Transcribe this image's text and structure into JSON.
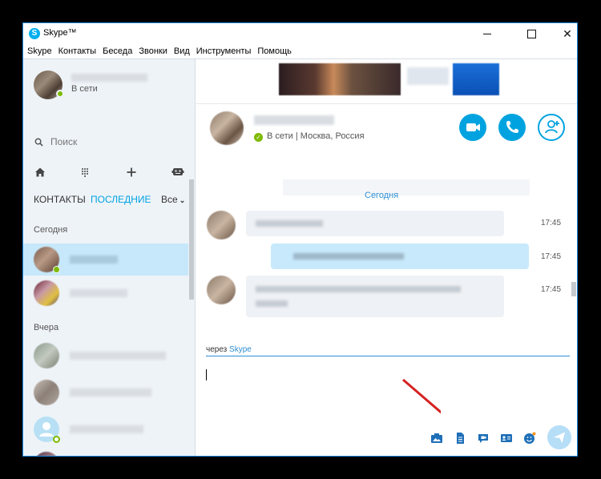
{
  "app": {
    "title": "Skype™"
  },
  "window_controls": {
    "minimize": "",
    "maximize": "",
    "close": ""
  },
  "menu": [
    "Skype",
    "Контакты",
    "Беседа",
    "Звонки",
    "Вид",
    "Инструменты",
    "Помощь"
  ],
  "profile": {
    "presence": "В сети"
  },
  "search": {
    "placeholder": "Поиск"
  },
  "nav_icons": [
    "home-icon",
    "dialpad-icon",
    "add-icon",
    "bot-icon"
  ],
  "tabs": {
    "contacts": "КОНТАКТЫ",
    "recent": "ПОСЛЕДНИЕ",
    "all": "Все"
  },
  "sections": {
    "today": "Сегодня",
    "yesterday": "Вчера"
  },
  "conversation": {
    "presence": "В сети | Москва, Россия",
    "date_label": "Сегодня",
    "messages": [
      {
        "time": "17:45"
      },
      {
        "time": "17:45"
      },
      {
        "time": "17:45"
      }
    ]
  },
  "compose": {
    "via_prefix": "через",
    "via_service": "Skype"
  },
  "colors": {
    "accent": "#00a3e0",
    "selected_row": "#c6e8fa",
    "online": "#7fba00",
    "link": "#2d8fd5"
  }
}
